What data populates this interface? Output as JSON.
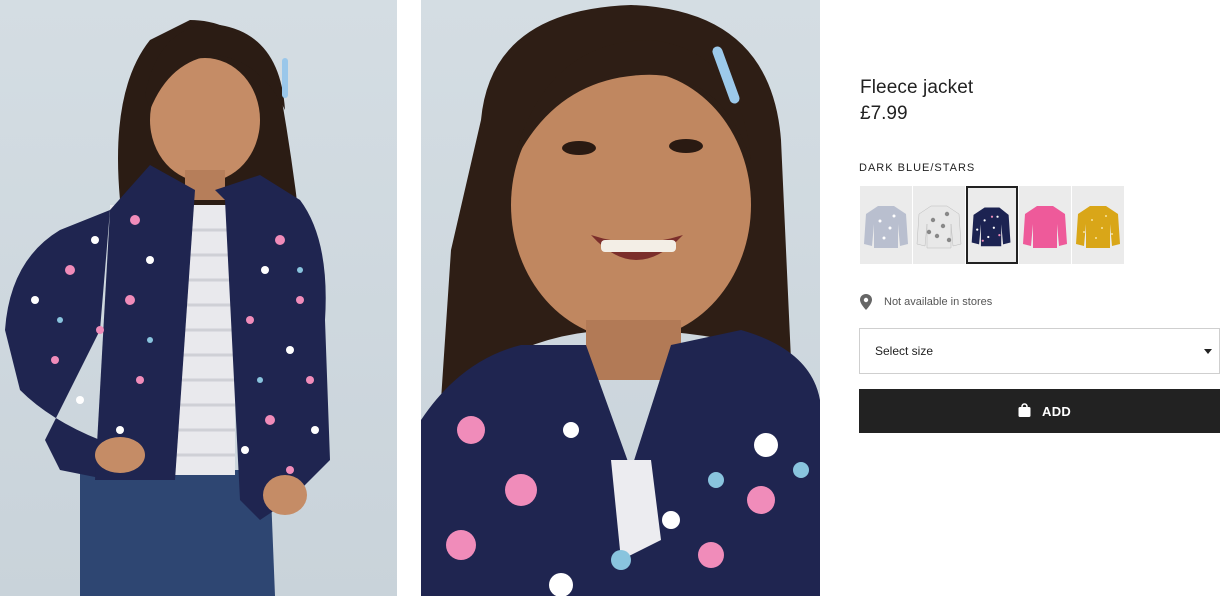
{
  "gallery": {
    "images": [
      {
        "name": "model-full-view"
      },
      {
        "name": "model-close-up"
      }
    ]
  },
  "product": {
    "title": "Fleece jacket",
    "price": "£7.99",
    "selected_color": "DARK BLUE/STARS",
    "swatches": [
      {
        "name": "grey-print",
        "color": "#b9bfcf",
        "selected": false
      },
      {
        "name": "white-grey-print",
        "color": "#d8d8d8",
        "selected": false
      },
      {
        "name": "dark-blue-stars",
        "color": "#1c2352",
        "selected": true
      },
      {
        "name": "pink",
        "color": "#ee5a9a",
        "selected": false
      },
      {
        "name": "yellow-dots",
        "color": "#d9a618",
        "selected": false
      }
    ],
    "availability": {
      "icon": "location-pin-icon",
      "text": "Not available in stores"
    },
    "size_select": {
      "label": "Select size",
      "icon": "caret-down-icon"
    },
    "add_button": {
      "icon": "shopping-bag-icon",
      "label": "ADD"
    }
  },
  "colors": {
    "button_bg": "#222222",
    "jacket_navy": "#1f2550",
    "text": "#222222"
  }
}
